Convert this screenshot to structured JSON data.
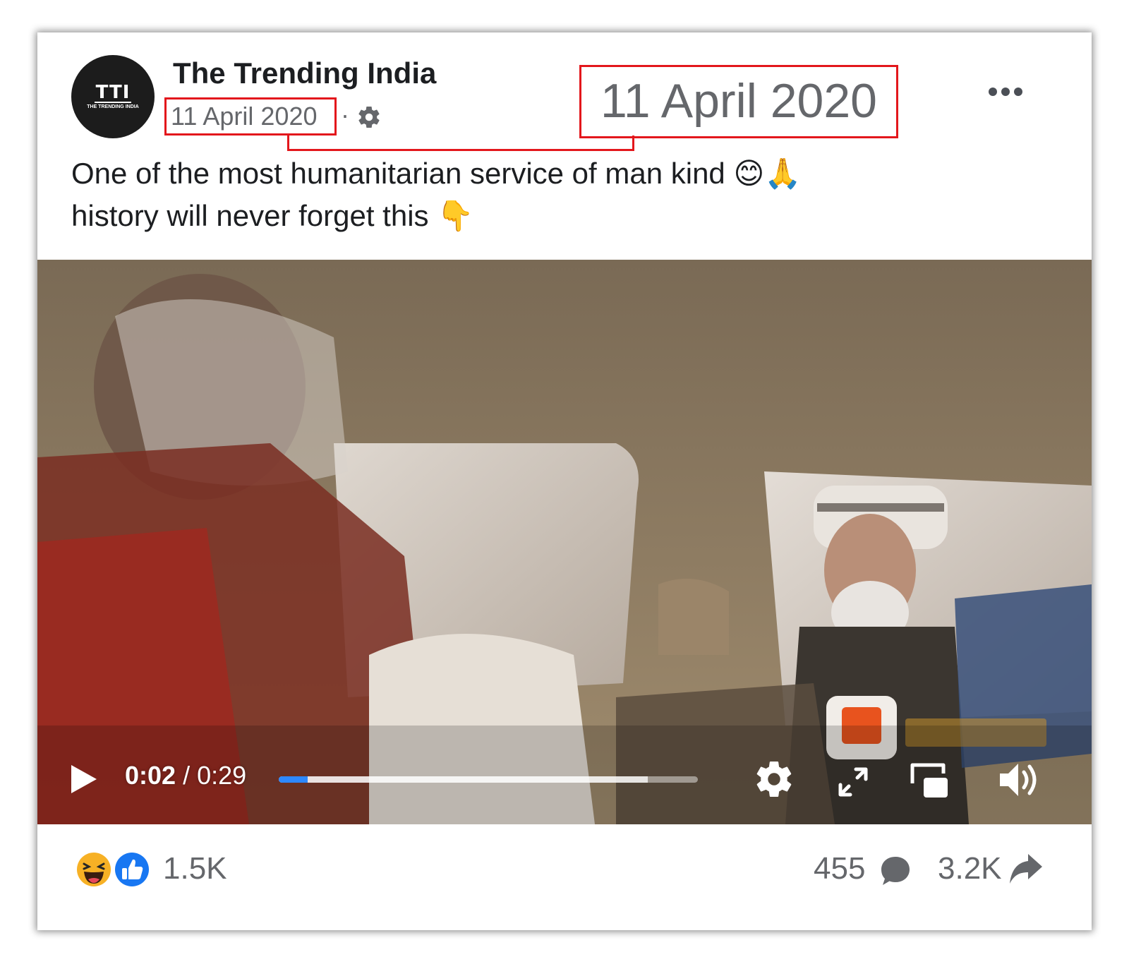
{
  "post": {
    "page_name": "The Trending India",
    "avatar_monogram": "TTI",
    "avatar_subtitle": "THE TRENDING INDIA",
    "date": "11 April 2020",
    "separator": "·",
    "privacy_icon": "gear-icon",
    "more_icon": "more-dots-icon",
    "caption_line1": "One of the most humanitarian service of man kind",
    "caption_line1_emoji": "😊🙏",
    "caption_line2": "history will never forget this",
    "caption_line2_emoji": "👇"
  },
  "annotation": {
    "zoomed_date": "11 April 2020",
    "highlight_color": "#e3171c"
  },
  "video": {
    "current_time": "0:02",
    "separator": "/",
    "duration": "0:29",
    "progress_fraction": 0.069,
    "buffered_fraction": 0.88,
    "progress_color": "#2d88ff",
    "controls": [
      "play-icon",
      "settings-icon",
      "fullscreen-icon",
      "picture-in-picture-icon",
      "volume-icon"
    ]
  },
  "footer": {
    "reactions": [
      "haha-reaction-icon",
      "like-reaction-icon"
    ],
    "reaction_count": "1.5K",
    "comment_count": "455",
    "share_count": "3.2K",
    "like_color": "#1877f2",
    "haha_color": "#f7b125"
  }
}
